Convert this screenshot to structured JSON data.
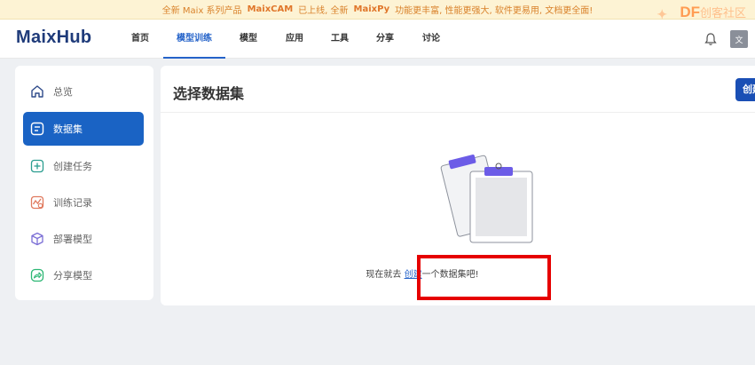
{
  "banner": {
    "prefix": "全新 Maix 系列产品",
    "product1": "MaixCAM",
    "mid": "已上线, 全新",
    "product2": "MaixPy",
    "suffix": "功能更丰富, 性能更强大, 软件更易用, 文档更全面!"
  },
  "watermark": {
    "brand": "DF",
    "sub": "创客社区"
  },
  "header": {
    "logo": "MaixHub",
    "nav": [
      {
        "label": "首页"
      },
      {
        "label": "模型训练"
      },
      {
        "label": "模型"
      },
      {
        "label": "应用"
      },
      {
        "label": "工具"
      },
      {
        "label": "分享"
      },
      {
        "label": "讨论"
      }
    ],
    "lang_label": "文"
  },
  "sidebar": {
    "items": [
      {
        "label": "总览",
        "icon": "home-icon"
      },
      {
        "label": "数据集",
        "icon": "dataset-icon"
      },
      {
        "label": "创建任务",
        "icon": "plus-icon"
      },
      {
        "label": "训练记录",
        "icon": "history-icon"
      },
      {
        "label": "部署模型",
        "icon": "cube-icon"
      },
      {
        "label": "分享模型",
        "icon": "share-icon"
      }
    ]
  },
  "main": {
    "title": "选择数据集",
    "create_button": "创建",
    "empty_prefix": "现在就去",
    "empty_link": "创建",
    "empty_suffix": "一个数据集吧!"
  },
  "colors": {
    "primary": "#1a63c4",
    "highlight": "#e60000",
    "banner_bg": "#fdf3d4",
    "banner_text": "#d9822b"
  }
}
